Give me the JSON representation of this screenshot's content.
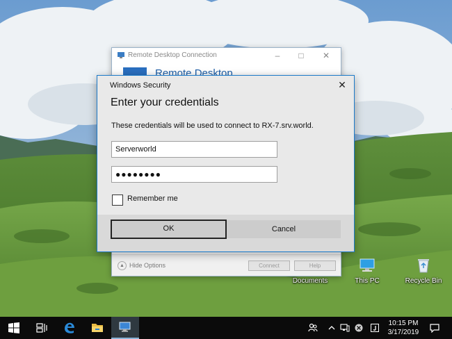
{
  "desktop": {
    "icons": [
      {
        "label": "Documents",
        "icon": "documents-folder-icon"
      },
      {
        "label": "This PC",
        "icon": "this-pc-icon"
      },
      {
        "label": "Recycle Bin",
        "icon": "recycle-bin-icon"
      }
    ]
  },
  "rdc_window": {
    "title": "Remote Desktop Connection",
    "banner_text": "Remote Desktop",
    "hide_options": "Hide Options",
    "connect_label": "Connect",
    "help_label": "Help"
  },
  "dialog": {
    "caption": "Windows Security",
    "heading": "Enter your credentials",
    "description": "These credentials will be used to connect to RX-7.srv.world.",
    "username_value": "Serverworld",
    "password_value": "●●●●●●●●",
    "remember_label": "Remember me",
    "remember_checked": false,
    "ok_label": "OK",
    "cancel_label": "Cancel",
    "close_glyph": "✕"
  },
  "taskbar": {
    "time": "10:15 PM",
    "date": "3/17/2019",
    "accent": "#0078d7"
  }
}
